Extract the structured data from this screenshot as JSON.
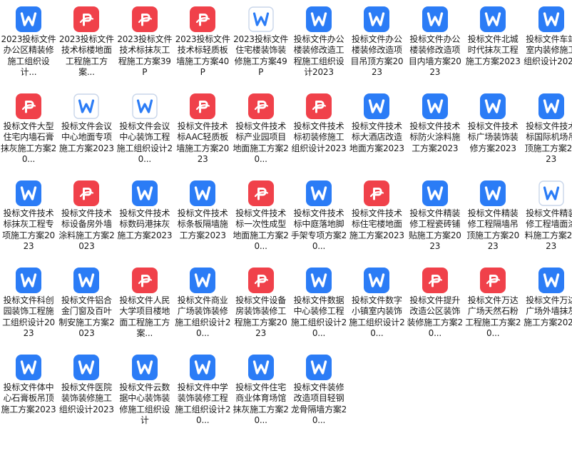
{
  "files": [
    {
      "type": "word",
      "name": "2023投标文件办公区精装修施工组织设计..."
    },
    {
      "type": "pdf",
      "name": "2023投标文件技术标楼地面工程施工方案..."
    },
    {
      "type": "pdf",
      "name": "2023投标文件技术标抹灰工程施工方案39P"
    },
    {
      "type": "pdf",
      "name": "2023投标文件技术标轻质板墙施工方案40P"
    },
    {
      "type": "word-outline",
      "name": "2023投标文件住宅楼装饰装修施工方案49P"
    },
    {
      "type": "word",
      "name": "投标文件办公楼装修改造工程施工组织设计2023"
    },
    {
      "type": "word",
      "name": "投标文件办公楼装修改造项目吊顶方案2023"
    },
    {
      "type": "word",
      "name": "投标文件办公楼装修改造项目内墙方案2023"
    },
    {
      "type": "word",
      "name": "投标文件北城时代抹灰工程施工方案2023"
    },
    {
      "type": "word",
      "name": "投标文件车站室内装修施工组织设计2023"
    },
    {
      "type": "pdf",
      "name": "投标文件大型住宅内墙石膏抹灰施工方案20..."
    },
    {
      "type": "word-outline",
      "name": "投标文件会议中心地面专项施工方案2023"
    },
    {
      "type": "word-outline",
      "name": "投标文件会议中心装饰工程施工组织设计20..."
    },
    {
      "type": "pdf",
      "name": "投标文件技术标AAC轻质板墙施工方案2023"
    },
    {
      "type": "pdf",
      "name": "投标文件技术标产业园项目地面施工方案20..."
    },
    {
      "type": "pdf",
      "name": "投标文件技术标初装修施工组织设计2023"
    },
    {
      "type": "word",
      "name": "投标文件技术标大酒店改造地面方案2023"
    },
    {
      "type": "word",
      "name": "投标文件技术标防火涂料施工方案2023"
    },
    {
      "type": "word",
      "name": "投标文件技术标广场装饰装修方案2023"
    },
    {
      "type": "word",
      "name": "投标文件技术标国际机场吊顶施工方案2023"
    },
    {
      "type": "word",
      "name": "投标文件技术标抹灰工程专项施工方案2023"
    },
    {
      "type": "pdf",
      "name": "投标文件技术标设备房外墙涂料施工方案2023"
    },
    {
      "type": "word",
      "name": "投标文件技术标数码港抹灰施工方案2023"
    },
    {
      "type": "word",
      "name": "投标文件技术标条板隔墙施工方案2023"
    },
    {
      "type": "pdf",
      "name": "投标文件技术标一次性成型地面施工方案20..."
    },
    {
      "type": "word",
      "name": "投标文件技术标中庭落地脚手架专项方案20..."
    },
    {
      "type": "pdf",
      "name": "投标文件技术标住宅楼地面施工方案2023"
    },
    {
      "type": "word",
      "name": "投标文件精装修工程瓷砖铺贴施工方案2023"
    },
    {
      "type": "word",
      "name": "投标文件精装修工程隔墙吊顶施工方案2023"
    },
    {
      "type": "word-outline",
      "name": "投标文件精装修工程墙面涂料施工方案2023"
    },
    {
      "type": "word",
      "name": "投标文件科创园装饰工程施工组织设计2023"
    },
    {
      "type": "word",
      "name": "投标文件铝合金门窗及百叶制安施工方案2023"
    },
    {
      "type": "pdf",
      "name": "投标文件人民大学项目楼地面工程施工方案..."
    },
    {
      "type": "word",
      "name": "投标文件商业广场装饰装修施工组织设计20..."
    },
    {
      "type": "pdf",
      "name": "投标文件设备房装饰装修工程施工方案2023"
    },
    {
      "type": "word",
      "name": "投标文件数据中心装修工程施工组织设计20..."
    },
    {
      "type": "word",
      "name": "投标文件数字小镇室内装饰施工组织设计20..."
    },
    {
      "type": "pdf",
      "name": "投标文件提升改造公区装饰装修施工方案20..."
    },
    {
      "type": "pdf",
      "name": "投标文件万达广场天然石粉工程施工方案20..."
    },
    {
      "type": "word",
      "name": "投标文件万达广场外墙抹灰施工方案2023"
    },
    {
      "type": "word",
      "name": "投标文件体中心石膏板吊顶施工方案2023"
    },
    {
      "type": "word",
      "name": "投标文件医院装饰装修施工组织设计2023"
    },
    {
      "type": "word",
      "name": "投标文件云数据中心装饰装修施工组织设计"
    },
    {
      "type": "word",
      "name": "投标文件中学装饰装修工程施工组织设计20..."
    },
    {
      "type": "word",
      "name": "投标文件住宅商业体育场馆抹灰施工方案20..."
    },
    {
      "type": "word",
      "name": "投标文件装修改造项目轻钢龙骨隔墙方案20..."
    }
  ]
}
